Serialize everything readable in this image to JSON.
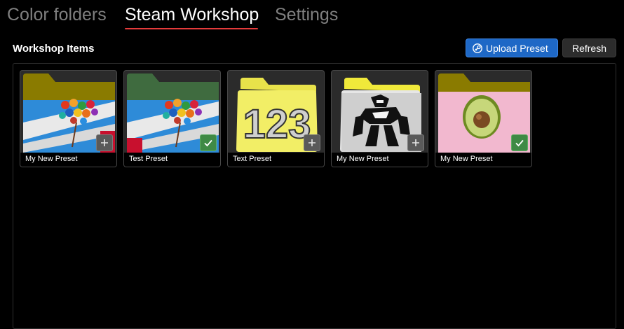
{
  "tabs": {
    "color_folders": "Color folders",
    "steam_workshop": "Steam Workshop",
    "settings": "Settings"
  },
  "header": {
    "title": "Workshop Items",
    "upload_label": "Upload Preset",
    "refresh_label": "Refresh"
  },
  "items": [
    {
      "name": "My New Preset",
      "status": "add",
      "thumb": "balloons-folder"
    },
    {
      "name": "Test Preset",
      "status": "subscribed",
      "thumb": "balloons-folder-green"
    },
    {
      "name": "Text Preset",
      "status": "add",
      "thumb": "123-yellow-folder"
    },
    {
      "name": "My New Preset",
      "status": "add",
      "thumb": "robot-yellow-folder"
    },
    {
      "name": "My New Preset",
      "status": "subscribed",
      "thumb": "avocado-folder"
    }
  ],
  "colors": {
    "accent_underline": "#e53b3b",
    "upload_button": "#1e68c6",
    "subscribed_badge": "#3f8a45",
    "add_badge": "#5a5a5a"
  }
}
